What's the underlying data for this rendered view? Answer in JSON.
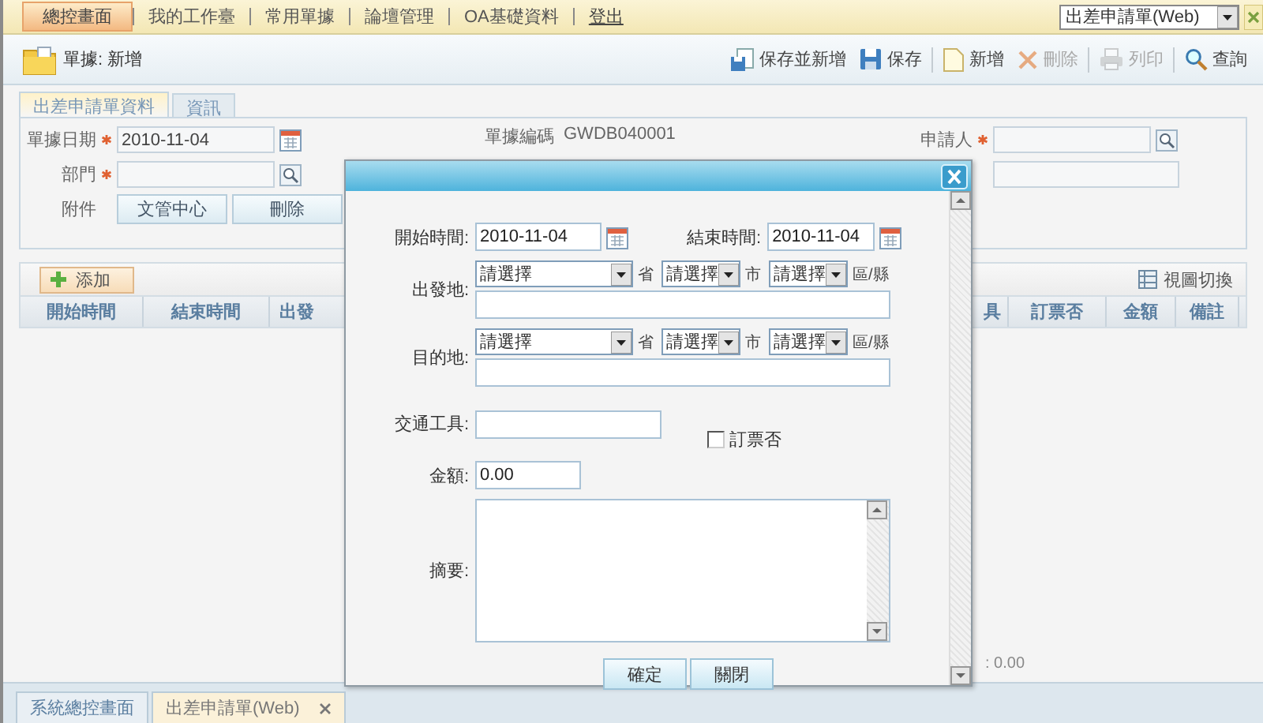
{
  "top_nav": {
    "items": [
      {
        "label": "總控畫面",
        "kind": "tab",
        "selected": true
      },
      {
        "label": "我的工作臺",
        "kind": "tab",
        "selected": false
      },
      {
        "label": "常用單據",
        "kind": "tab",
        "selected": false
      },
      {
        "label": "論壇管理",
        "kind": "tab",
        "selected": false
      },
      {
        "label": "OA基礎資料",
        "kind": "tab",
        "selected": false
      },
      {
        "label": "登出",
        "kind": "link",
        "selected": false
      }
    ],
    "form_select": {
      "value": "出差申請單(Web)"
    }
  },
  "page_header": {
    "title": "單據: 新增"
  },
  "toolbar": [
    {
      "label": "保存並新增",
      "kind": "save-new",
      "disabled": false
    },
    {
      "label": "保存",
      "kind": "save",
      "disabled": false
    },
    {
      "label": "新增",
      "kind": "new",
      "disabled": false
    },
    {
      "label": "刪除",
      "kind": "delete",
      "disabled": true
    },
    {
      "label": "列印",
      "kind": "print",
      "disabled": true
    },
    {
      "label": "查詢",
      "kind": "search",
      "disabled": false
    }
  ],
  "form_tabs": [
    {
      "label": "出差申請單資料",
      "selected": true
    },
    {
      "label": "資訊",
      "selected": false
    }
  ],
  "form": {
    "left": [
      {
        "label": "單據日期",
        "required": true,
        "kind": "date",
        "value": "2010-11-04"
      },
      {
        "label": "部門",
        "required": true,
        "kind": "lookup"
      },
      {
        "label": "附件",
        "kind": "buttons",
        "buttons": [
          "文管中心",
          "刪除"
        ]
      }
    ],
    "middle": {
      "label": "單據編碼",
      "value": "GWDB040001"
    },
    "right": [
      {
        "label": "申請人",
        "required": true,
        "kind": "lookup"
      },
      {
        "kind": "text"
      }
    ]
  },
  "detail_grid": {
    "add_button": "添加",
    "view_switch": "視圖切換",
    "columns_left": [
      "開始時間",
      "結束時間",
      "出發"
    ],
    "columns_right": [
      "具",
      "訂票否",
      "金額",
      "備註"
    ],
    "total": ": 0.00"
  },
  "dialog": {
    "start_time": {
      "label": "開始時間:",
      "value": "2010-11-04"
    },
    "end_time": {
      "label": "結束時間:",
      "value": "2010-11-04"
    },
    "places": [
      {
        "label": "出發地:",
        "selects": [
          {
            "value": "請選擇",
            "unit": "省"
          },
          {
            "value": "請選擇",
            "unit": "市"
          },
          {
            "value": "請選擇",
            "unit": "區/縣"
          }
        ]
      },
      {
        "label": "目的地:",
        "selects": [
          {
            "value": "請選擇",
            "unit": "省"
          },
          {
            "value": "請選擇",
            "unit": "市"
          },
          {
            "value": "請選擇",
            "unit": "區/縣"
          }
        ]
      }
    ],
    "transport": {
      "label": "交通工具:"
    },
    "ticket": {
      "label": "訂票否",
      "checked": false
    },
    "amount": {
      "label": "金額:",
      "value": "0.00"
    },
    "summary": {
      "label": "摘要:"
    },
    "buttons": [
      "確定",
      "關閉"
    ]
  },
  "bottom_tabs": [
    {
      "label": "系統總控畫面",
      "selected": false,
      "closable": false
    },
    {
      "label": "出差申請單(Web)",
      "selected": true,
      "closable": true
    }
  ]
}
